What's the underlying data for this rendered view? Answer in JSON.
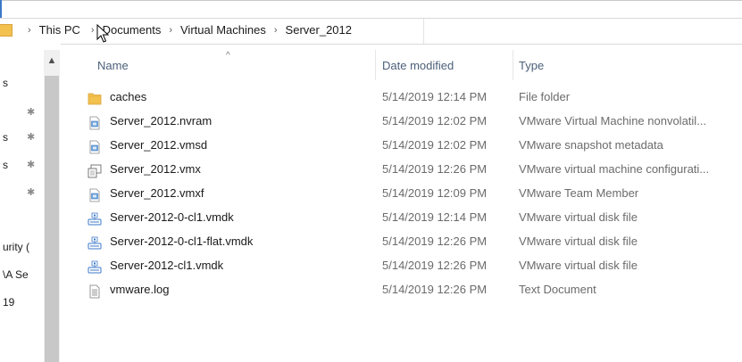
{
  "address_bar": {
    "crumbs": [
      "This PC",
      "Documents",
      "Virtual Machines",
      "Server_2012"
    ],
    "separator": "›",
    "folder_icon": "folder-icon"
  },
  "nav_pane": {
    "fragments": [
      "s",
      "s",
      "s",
      "urity (",
      "\\A Se",
      "19"
    ]
  },
  "columns": {
    "name": "Name",
    "date": "Date modified",
    "type": "Type",
    "sorted_column": "name"
  },
  "files": [
    {
      "name": "caches",
      "date": "5/14/2019 12:14 PM",
      "type": "File folder",
      "icon": "folder-icon"
    },
    {
      "name": "Server_2012.nvram",
      "date": "5/14/2019 12:02 PM",
      "type": "VMware Virtual Machine nonvolatil...",
      "icon": "vmware-file-icon"
    },
    {
      "name": "Server_2012.vmsd",
      "date": "5/14/2019 12:02 PM",
      "type": "VMware snapshot metadata",
      "icon": "vmware-file-icon"
    },
    {
      "name": "Server_2012.vmx",
      "date": "5/14/2019 12:26 PM",
      "type": "VMware virtual machine configurati...",
      "icon": "vm-config-icon"
    },
    {
      "name": "Server_2012.vmxf",
      "date": "5/14/2019 12:09 PM",
      "type": "VMware Team Member",
      "icon": "vmware-file-icon"
    },
    {
      "name": "Server-2012-0-cl1.vmdk",
      "date": "5/14/2019 12:14 PM",
      "type": "VMware virtual disk file",
      "icon": "virtual-disk-icon"
    },
    {
      "name": "Server-2012-0-cl1-flat.vmdk",
      "date": "5/14/2019 12:26 PM",
      "type": "VMware virtual disk file",
      "icon": "virtual-disk-icon"
    },
    {
      "name": "Server-2012-cl1.vmdk",
      "date": "5/14/2019 12:26 PM",
      "type": "VMware virtual disk file",
      "icon": "virtual-disk-icon"
    },
    {
      "name": "vmware.log",
      "date": "5/14/2019 12:26 PM",
      "type": "Text Document",
      "icon": "text-document-icon"
    }
  ],
  "colors": {
    "accent": "#3c78c8",
    "folder": "#f2c14e",
    "header_text": "#4c607a",
    "secondary_text": "#6b6b6b"
  }
}
